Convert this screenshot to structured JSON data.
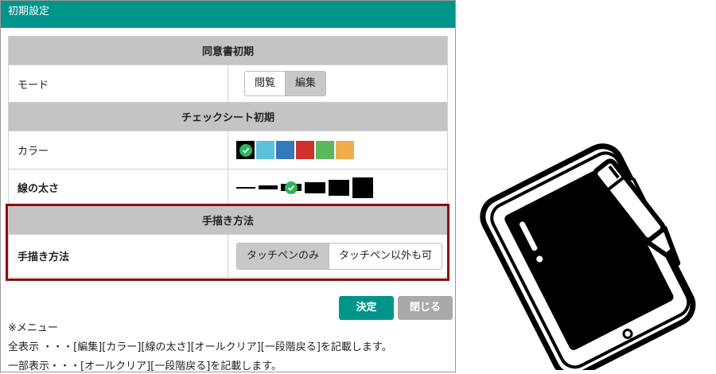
{
  "dialog": {
    "title": "初期設定",
    "section_agreement": "同意書初期",
    "mode": {
      "label": "モード",
      "options": [
        "閲覧",
        "編集"
      ],
      "selected": "編集"
    },
    "section_checksheet": "チェックシート初期",
    "color": {
      "label": "カラー",
      "swatches": [
        "#000000",
        "#5bc0de",
        "#337ab7",
        "#d0312d",
        "#5cb85c",
        "#f0ad4e"
      ],
      "selected_index": 0
    },
    "line_width": {
      "label": "線の太さ",
      "selected_index": 2
    },
    "section_handwriting": "手描き方法",
    "handwriting": {
      "label": "手描き方法",
      "options": [
        "タッチペンのみ",
        "タッチペン以外も可"
      ],
      "selected": "タッチペンのみ"
    },
    "buttons": {
      "ok": "決定",
      "close": "閉じる"
    },
    "notes": {
      "menu_header": "※メニュー",
      "full_display": "全表示 ・・・[編集][カラー][線の太さ][オールクリア][一段階戻る]を記載します。",
      "partial_display": "一部表示・・・[オールクリア][一段階戻る]を記載します。"
    }
  },
  "colors": {
    "titlebar": "#00958a",
    "highlight_border": "#8b0d0d",
    "selected_segment": "#c8c8c8"
  },
  "icons": [
    "check-icon",
    "tablet-pen-icon"
  ]
}
